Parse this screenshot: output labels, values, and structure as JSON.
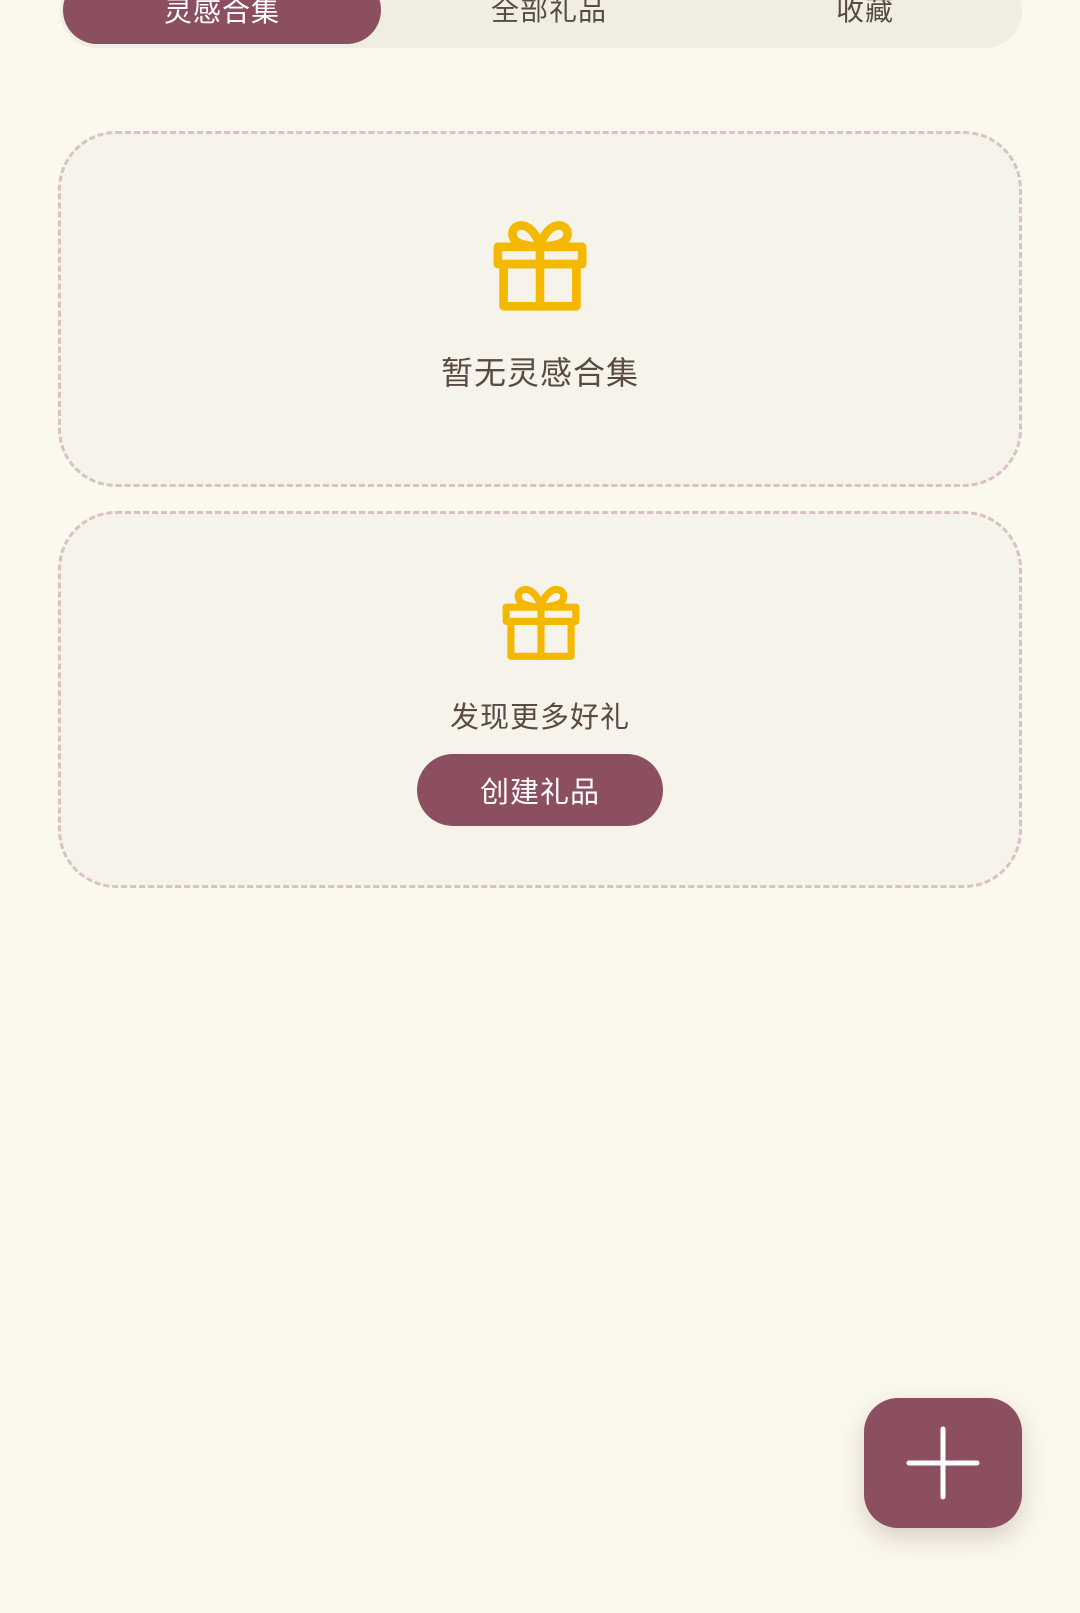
{
  "tabs": [
    {
      "label": "灵感合集",
      "active": true
    },
    {
      "label": "全部礼品",
      "active": false
    },
    {
      "label": "收藏",
      "active": false
    }
  ],
  "empty_collection": {
    "icon": "gift-icon",
    "message": "暂无灵感合集"
  },
  "discover": {
    "icon": "gift-icon",
    "message": "发现更多好礼",
    "button_label": "创建礼品"
  },
  "fab": {
    "icon": "plus-icon"
  },
  "colors": {
    "background": "#fbf9ee",
    "accent": "#8b4f5f",
    "gift_icon": "#f5b800",
    "card_background": "#f6f4ea",
    "card_border": "#d9c2c0",
    "text": "#5a4a44"
  }
}
